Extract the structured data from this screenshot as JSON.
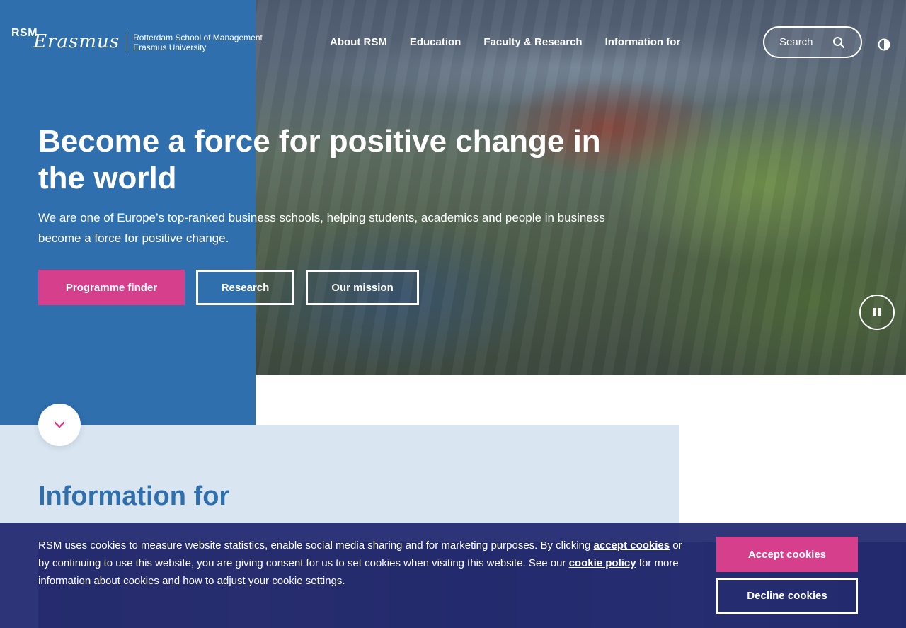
{
  "header": {
    "logo_mark": "RSM",
    "logo_script": "Erasmus",
    "logo_line1": "Rotterdam School of Management",
    "logo_line2": "Erasmus University",
    "nav": [
      "About RSM",
      "Education",
      "Faculty & Research",
      "Information for"
    ],
    "search_placeholder": "Search"
  },
  "hero": {
    "title": "Become a force for positive change in the world",
    "subtitle": "We are one of Europe’s top-ranked business schools, helping students, academics and people in business become a force for positive change.",
    "buttons": {
      "primary": "Programme finder",
      "research": "Research",
      "mission": "Our mission"
    }
  },
  "info": {
    "title": "Information for"
  },
  "cookie": {
    "text_before": "RSM uses cookies to measure website statistics, enable social media sharing and for marketing purposes. By clicking ",
    "link_accept": "accept cookies",
    "text_middle": " or by continuing to use this website, you are giving consent for us to set cookies when visiting this website. See our ",
    "link_policy": "cookie policy",
    "text_after": " for more information about cookies and how to adjust your cookie settings.",
    "accept_label": "Accept cookies",
    "decline_label": "Decline cookies"
  },
  "icons": {
    "search": "search-icon",
    "contrast": "contrast-icon",
    "pause": "pause-icon",
    "scroll": "chevron-down-icon"
  },
  "colors": {
    "brand_blue": "#2f6fad",
    "accent_pink": "#d53f8c",
    "banner_navy": "#1e266e",
    "info_band": "#d9e6f2"
  }
}
